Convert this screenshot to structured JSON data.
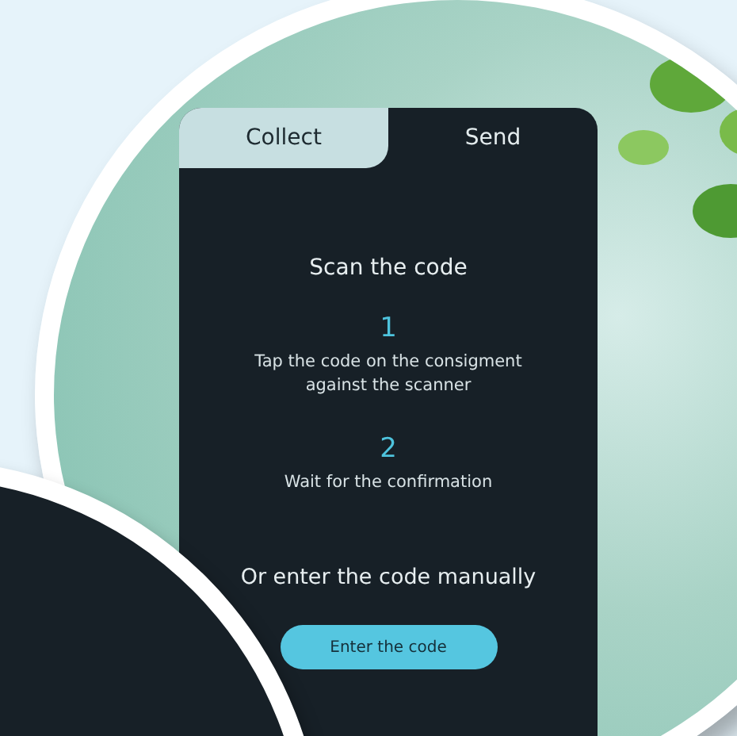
{
  "tabs": [
    {
      "label": "Collect",
      "selected": false
    },
    {
      "label": "Send",
      "selected": true
    }
  ],
  "title": "Scan the code",
  "steps": [
    {
      "number": "1",
      "text": "Tap the code on the consigment against the scanner"
    },
    {
      "number": "2",
      "text": "Wait for the confirmation"
    }
  ],
  "manual_label": "Or enter the code manually",
  "button": "Enter the code"
}
